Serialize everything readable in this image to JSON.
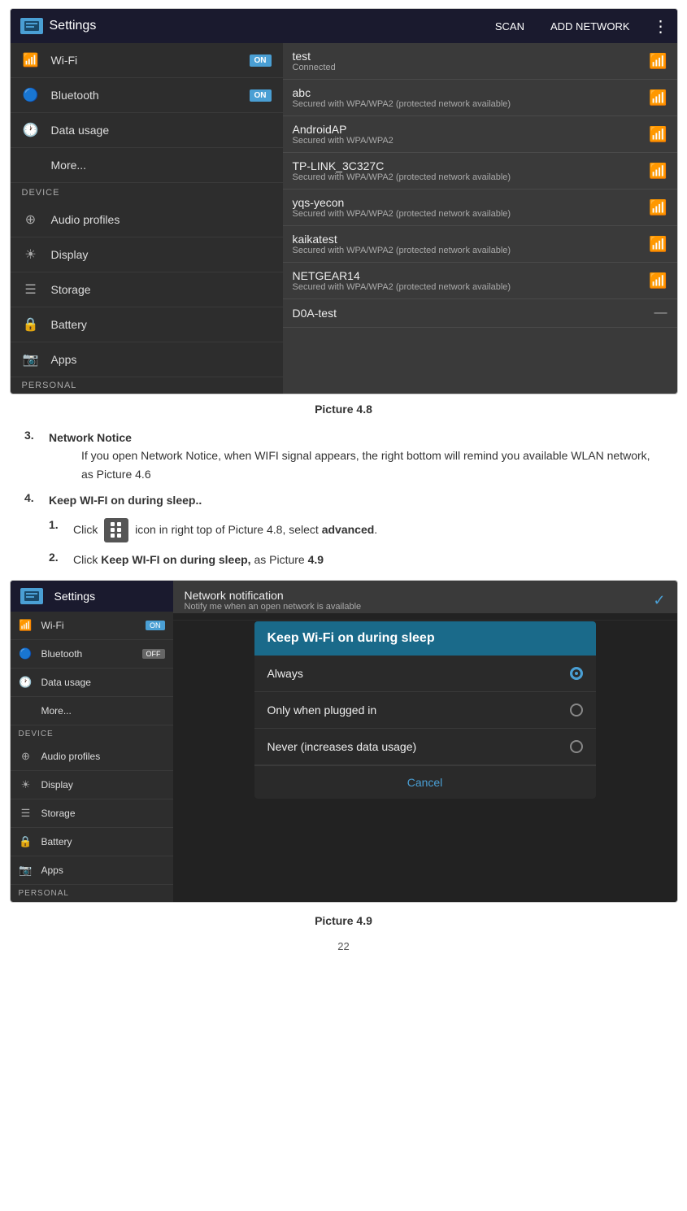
{
  "screenshot1": {
    "header": {
      "title": "Settings",
      "scan": "SCAN",
      "add_network": "ADD NETWORK"
    },
    "sidebar": {
      "items": [
        {
          "label": "Wi-Fi",
          "icon": "📶",
          "toggle": "ON"
        },
        {
          "label": "Bluetooth",
          "icon": "🔵",
          "toggle": "ON"
        },
        {
          "label": "Data usage",
          "icon": "🕐"
        },
        {
          "label": "More...",
          "icon": ""
        }
      ],
      "device_section": "DEVICE",
      "device_items": [
        {
          "label": "Audio profiles",
          "icon": "➕"
        },
        {
          "label": "Display",
          "icon": "🔆"
        },
        {
          "label": "Storage",
          "icon": "☰"
        },
        {
          "label": "Battery",
          "icon": "🔒"
        },
        {
          "label": "Apps",
          "icon": "📷"
        }
      ],
      "personal_section": "PERSONAL"
    },
    "networks": [
      {
        "name": "test",
        "status": "Connected",
        "signal": "strong"
      },
      {
        "name": "abc",
        "status": "Secured with WPA/WPA2 (protected network available)",
        "signal": "medium"
      },
      {
        "name": "AndroidAP",
        "status": "Secured with WPA/WPA2",
        "signal": "medium"
      },
      {
        "name": "TP-LINK_3C327C",
        "status": "Secured with WPA/WPA2 (protected network available)",
        "signal": "low"
      },
      {
        "name": "yqs-yecon",
        "status": "Secured with WPA/WPA2 (protected network available)",
        "signal": "low"
      },
      {
        "name": "kaikatest",
        "status": "Secured with WPA/WPA2 (protected network available)",
        "signal": "low"
      },
      {
        "name": "NETGEAR14",
        "status": "Secured with WPA/WPA2 (protected network available)",
        "signal": "low"
      },
      {
        "name": "D0A-test",
        "status": "",
        "signal": "none"
      }
    ]
  },
  "caption1": "Picture 4.8",
  "doc": {
    "item3_number": "3.",
    "item3_heading": "Network Notice",
    "item3_text": "If you open Network Notice, when WIFI signal appears, the right bottom will remind you available WLAN network, as Picture 4.6",
    "item4_number": "4.",
    "item4_heading": "Keep WI-FI on during sleep..",
    "step1_number": "1.",
    "step1_text_before": "Click",
    "step1_text_after": "icon in right top of Picture 4.8, select",
    "step1_bold": "advanced",
    "step1_period": ".",
    "step2_number": "2.",
    "step2_text_before": "Click",
    "step2_bold": "Keep WI-FI on during sleep,",
    "step2_text_after": "as Picture",
    "step2_pic": "4.9"
  },
  "caption2": "Picture 4.9",
  "screenshot2": {
    "header": {
      "title": "Settings"
    },
    "sidebar": {
      "items": [
        {
          "label": "Wi-Fi",
          "icon": "📶",
          "toggle": "ON"
        },
        {
          "label": "Bluetooth",
          "icon": "🔵",
          "toggle": "OFF"
        },
        {
          "label": "Data usage",
          "icon": "🕐"
        },
        {
          "label": "More...",
          "icon": ""
        }
      ],
      "device_section": "DEVICE",
      "device_items": [
        {
          "label": "Audio profiles",
          "icon": "➕"
        },
        {
          "label": "Display",
          "icon": "🔆"
        },
        {
          "label": "Storage",
          "icon": "☰"
        },
        {
          "label": "Battery",
          "icon": "🔒"
        },
        {
          "label": "Apps",
          "icon": "📷"
        }
      ],
      "personal_section": "PERSONAL"
    },
    "notification": {
      "title": "Network notification",
      "subtitle": "Notify me when an open network is available"
    },
    "dialog": {
      "title": "Keep Wi-Fi on during sleep",
      "options": [
        {
          "label": "Always",
          "selected": true
        },
        {
          "label": "Only when plugged in",
          "selected": false
        },
        {
          "label": "Never (increases data usage)",
          "selected": false
        }
      ],
      "cancel": "Cancel"
    }
  },
  "page_number": "22"
}
